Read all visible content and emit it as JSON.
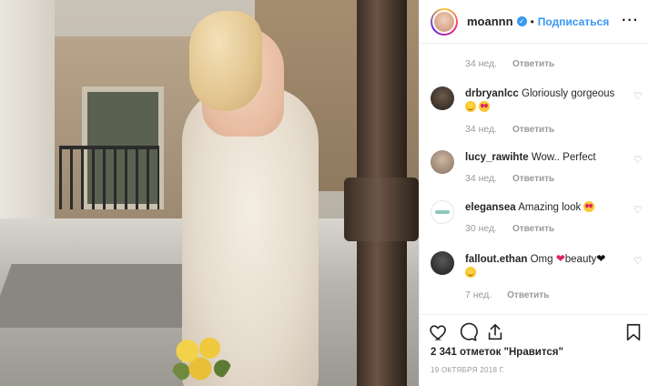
{
  "post": {
    "author": "moannn",
    "follow_label": "Подписаться",
    "likes_text": "2 341 отметок \"Нравится\"",
    "date": "19 ОКТЯБРЯ 2018 Г."
  },
  "comments": [
    {
      "user": "",
      "text": "",
      "age": "34 нед.",
      "reply": "Ответить"
    },
    {
      "user": "drbryanlcc",
      "text": "Gloriously gorgeous",
      "age": "34 нед.",
      "reply": "Ответить"
    },
    {
      "user": "lucy_rawihte",
      "text": "Wow.. Perfect",
      "age": "34 нед.",
      "reply": "Ответить"
    },
    {
      "user": "elegansea",
      "text": "Amazing look",
      "age": "30 нед.",
      "reply": "Ответить"
    },
    {
      "user": "fallout.ethan",
      "text_a": "Omg",
      "text_b": "beauty",
      "age": "7 нед.",
      "reply": "Ответить"
    }
  ],
  "icons": {
    "like": "heart-outline-icon",
    "comment": "speech-bubble-icon",
    "share": "share-icon",
    "save": "bookmark-icon",
    "more": "ellipsis-icon",
    "verified": "verified-badge-icon"
  },
  "colors": {
    "accent": "#3897f0",
    "text": "#262626",
    "muted": "#999999"
  }
}
